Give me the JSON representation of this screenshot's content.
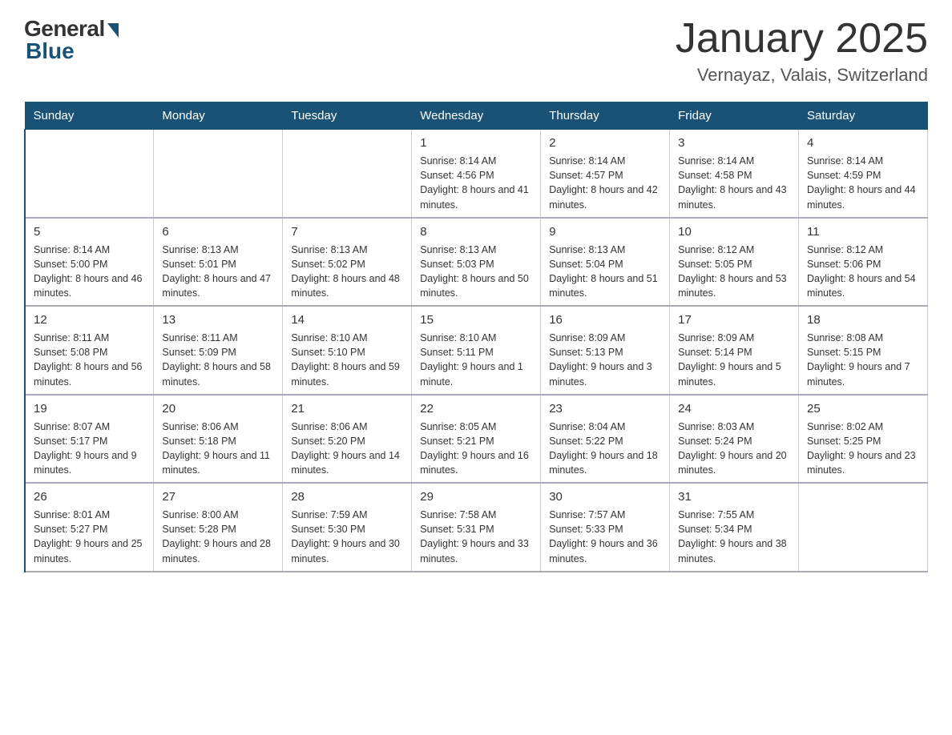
{
  "header": {
    "logo_general": "General",
    "logo_blue": "Blue",
    "title": "January 2025",
    "subtitle": "Vernayaz, Valais, Switzerland"
  },
  "days_of_week": [
    "Sunday",
    "Monday",
    "Tuesday",
    "Wednesday",
    "Thursday",
    "Friday",
    "Saturday"
  ],
  "weeks": [
    [
      {
        "day": "",
        "info": ""
      },
      {
        "day": "",
        "info": ""
      },
      {
        "day": "",
        "info": ""
      },
      {
        "day": "1",
        "info": "Sunrise: 8:14 AM\nSunset: 4:56 PM\nDaylight: 8 hours\nand 41 minutes."
      },
      {
        "day": "2",
        "info": "Sunrise: 8:14 AM\nSunset: 4:57 PM\nDaylight: 8 hours\nand 42 minutes."
      },
      {
        "day": "3",
        "info": "Sunrise: 8:14 AM\nSunset: 4:58 PM\nDaylight: 8 hours\nand 43 minutes."
      },
      {
        "day": "4",
        "info": "Sunrise: 8:14 AM\nSunset: 4:59 PM\nDaylight: 8 hours\nand 44 minutes."
      }
    ],
    [
      {
        "day": "5",
        "info": "Sunrise: 8:14 AM\nSunset: 5:00 PM\nDaylight: 8 hours\nand 46 minutes."
      },
      {
        "day": "6",
        "info": "Sunrise: 8:13 AM\nSunset: 5:01 PM\nDaylight: 8 hours\nand 47 minutes."
      },
      {
        "day": "7",
        "info": "Sunrise: 8:13 AM\nSunset: 5:02 PM\nDaylight: 8 hours\nand 48 minutes."
      },
      {
        "day": "8",
        "info": "Sunrise: 8:13 AM\nSunset: 5:03 PM\nDaylight: 8 hours\nand 50 minutes."
      },
      {
        "day": "9",
        "info": "Sunrise: 8:13 AM\nSunset: 5:04 PM\nDaylight: 8 hours\nand 51 minutes."
      },
      {
        "day": "10",
        "info": "Sunrise: 8:12 AM\nSunset: 5:05 PM\nDaylight: 8 hours\nand 53 minutes."
      },
      {
        "day": "11",
        "info": "Sunrise: 8:12 AM\nSunset: 5:06 PM\nDaylight: 8 hours\nand 54 minutes."
      }
    ],
    [
      {
        "day": "12",
        "info": "Sunrise: 8:11 AM\nSunset: 5:08 PM\nDaylight: 8 hours\nand 56 minutes."
      },
      {
        "day": "13",
        "info": "Sunrise: 8:11 AM\nSunset: 5:09 PM\nDaylight: 8 hours\nand 58 minutes."
      },
      {
        "day": "14",
        "info": "Sunrise: 8:10 AM\nSunset: 5:10 PM\nDaylight: 8 hours\nand 59 minutes."
      },
      {
        "day": "15",
        "info": "Sunrise: 8:10 AM\nSunset: 5:11 PM\nDaylight: 9 hours\nand 1 minute."
      },
      {
        "day": "16",
        "info": "Sunrise: 8:09 AM\nSunset: 5:13 PM\nDaylight: 9 hours\nand 3 minutes."
      },
      {
        "day": "17",
        "info": "Sunrise: 8:09 AM\nSunset: 5:14 PM\nDaylight: 9 hours\nand 5 minutes."
      },
      {
        "day": "18",
        "info": "Sunrise: 8:08 AM\nSunset: 5:15 PM\nDaylight: 9 hours\nand 7 minutes."
      }
    ],
    [
      {
        "day": "19",
        "info": "Sunrise: 8:07 AM\nSunset: 5:17 PM\nDaylight: 9 hours\nand 9 minutes."
      },
      {
        "day": "20",
        "info": "Sunrise: 8:06 AM\nSunset: 5:18 PM\nDaylight: 9 hours\nand 11 minutes."
      },
      {
        "day": "21",
        "info": "Sunrise: 8:06 AM\nSunset: 5:20 PM\nDaylight: 9 hours\nand 14 minutes."
      },
      {
        "day": "22",
        "info": "Sunrise: 8:05 AM\nSunset: 5:21 PM\nDaylight: 9 hours\nand 16 minutes."
      },
      {
        "day": "23",
        "info": "Sunrise: 8:04 AM\nSunset: 5:22 PM\nDaylight: 9 hours\nand 18 minutes."
      },
      {
        "day": "24",
        "info": "Sunrise: 8:03 AM\nSunset: 5:24 PM\nDaylight: 9 hours\nand 20 minutes."
      },
      {
        "day": "25",
        "info": "Sunrise: 8:02 AM\nSunset: 5:25 PM\nDaylight: 9 hours\nand 23 minutes."
      }
    ],
    [
      {
        "day": "26",
        "info": "Sunrise: 8:01 AM\nSunset: 5:27 PM\nDaylight: 9 hours\nand 25 minutes."
      },
      {
        "day": "27",
        "info": "Sunrise: 8:00 AM\nSunset: 5:28 PM\nDaylight: 9 hours\nand 28 minutes."
      },
      {
        "day": "28",
        "info": "Sunrise: 7:59 AM\nSunset: 5:30 PM\nDaylight: 9 hours\nand 30 minutes."
      },
      {
        "day": "29",
        "info": "Sunrise: 7:58 AM\nSunset: 5:31 PM\nDaylight: 9 hours\nand 33 minutes."
      },
      {
        "day": "30",
        "info": "Sunrise: 7:57 AM\nSunset: 5:33 PM\nDaylight: 9 hours\nand 36 minutes."
      },
      {
        "day": "31",
        "info": "Sunrise: 7:55 AM\nSunset: 5:34 PM\nDaylight: 9 hours\nand 38 minutes."
      },
      {
        "day": "",
        "info": ""
      }
    ]
  ]
}
